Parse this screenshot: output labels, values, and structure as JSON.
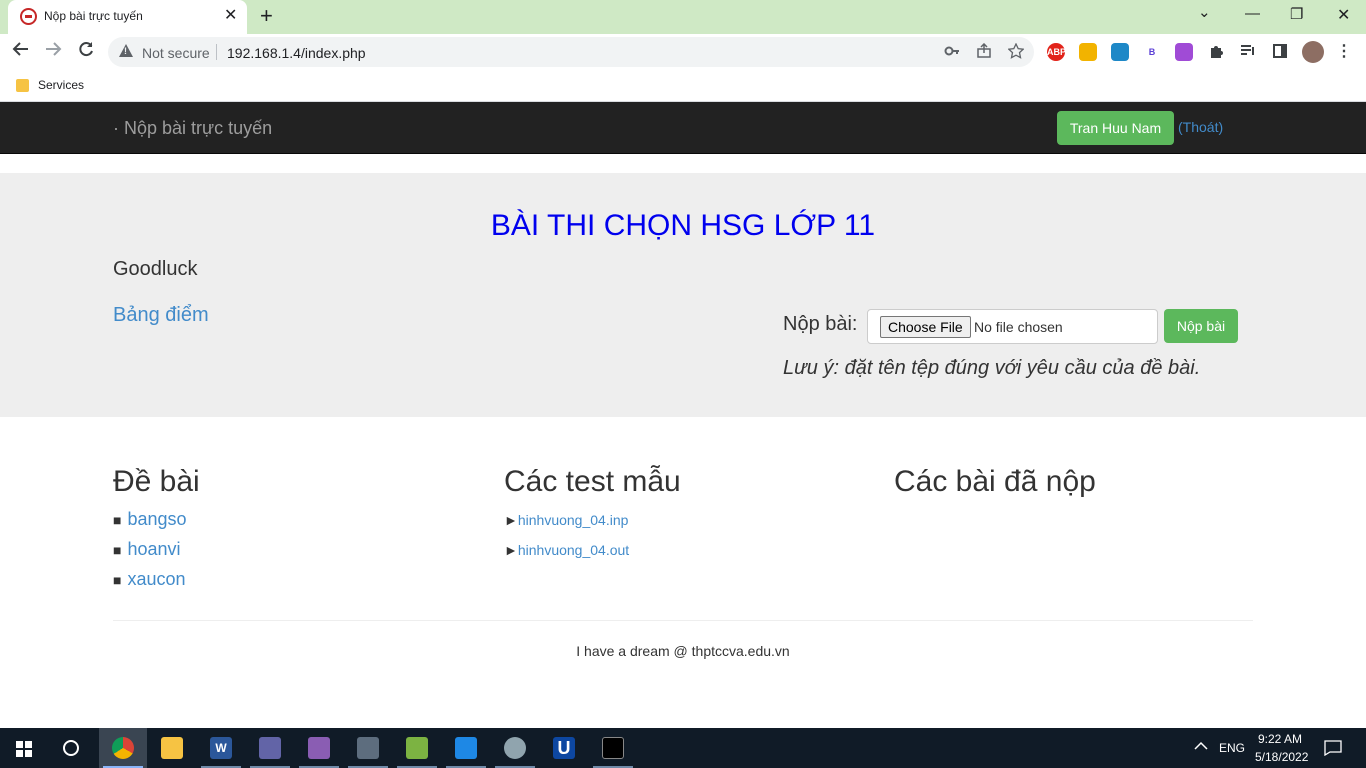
{
  "browser": {
    "tab_title": "Nộp bài trực tuyến",
    "tab_close": "✕",
    "new_tab": "+",
    "controls": {
      "dropdown": "⌄",
      "minimize": "—",
      "maximize": "❐",
      "close": "✕"
    },
    "security_label": "Not secure",
    "url": "192.168.1.4/index.php",
    "bookmark": "Services",
    "extensions": [
      "ABP",
      "B"
    ]
  },
  "navbar": {
    "brand": "· Nộp bài trực tuyến",
    "user": "Tran Huu Nam",
    "logout": "(Thoát)"
  },
  "header": {
    "title": "BÀI THI CHỌN HSG LỚP 11",
    "greeting": "Goodluck",
    "scoreboard_link": "Bảng điểm",
    "submit_label": "Nộp bài:",
    "choose_file": "Choose File",
    "no_file": "No file chosen",
    "submit_button": "Nộp bài",
    "note": "Lưu ý: đặt tên tệp đúng với yêu cầu của đề bài."
  },
  "problems": {
    "title": "Đề bài",
    "bullet": "■",
    "items": [
      "bangso",
      "hoanvi",
      "xaucon"
    ]
  },
  "samples": {
    "title": "Các test mẫu",
    "arrow": "►",
    "items": [
      "hinhvuong_04.inp",
      "hinhvuong_04.out"
    ]
  },
  "submitted": {
    "title": "Các bài đã nộp"
  },
  "footer": "I have a dream @ thptccva.edu.vn",
  "taskbar": {
    "language": "ENG",
    "time": "9:22 AM",
    "date": "5/18/2022"
  }
}
